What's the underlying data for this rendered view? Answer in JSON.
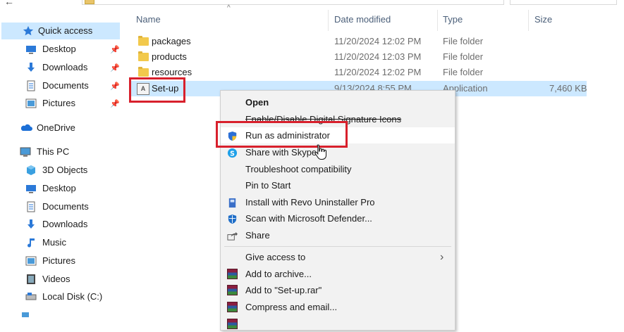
{
  "columns": {
    "name": "Name",
    "date": "Date modified",
    "type": "Type",
    "size": "Size"
  },
  "sidebar": {
    "quick_access": "Quick access",
    "quick_items": [
      {
        "label": "Desktop",
        "icon": "desktop-icon"
      },
      {
        "label": "Downloads",
        "icon": "download-icon"
      },
      {
        "label": "Documents",
        "icon": "document-icon"
      },
      {
        "label": "Pictures",
        "icon": "pictures-icon"
      }
    ],
    "onedrive": "OneDrive",
    "this_pc": "This PC",
    "pc_items": [
      {
        "label": "3D Objects",
        "icon": "cube-icon"
      },
      {
        "label": "Desktop",
        "icon": "desktop-icon"
      },
      {
        "label": "Documents",
        "icon": "document-icon"
      },
      {
        "label": "Downloads",
        "icon": "download-icon"
      },
      {
        "label": "Music",
        "icon": "music-icon"
      },
      {
        "label": "Pictures",
        "icon": "pictures-icon"
      },
      {
        "label": "Videos",
        "icon": "video-icon"
      },
      {
        "label": "Local Disk (C:)",
        "icon": "drive-icon"
      }
    ]
  },
  "files": [
    {
      "name": "packages",
      "date": "11/20/2024 12:02 PM",
      "type": "File folder",
      "size": ""
    },
    {
      "name": "products",
      "date": "11/20/2024 12:03 PM",
      "type": "File folder",
      "size": ""
    },
    {
      "name": "resources",
      "date": "11/20/2024 12:02 PM",
      "type": "File folder",
      "size": ""
    },
    {
      "name": "Set-up",
      "date": "9/13/2024 8:55 PM",
      "type": "Application",
      "size": "7,460 KB"
    }
  ],
  "context_menu": {
    "open": "Open",
    "signature": "Enable/Disable Digital Signature Icons",
    "run_admin": "Run as administrator",
    "skype": "Share with Skype",
    "troubleshoot": "Troubleshoot compatibility",
    "pin_start": "Pin to Start",
    "revo": "Install with Revo Uninstaller Pro",
    "defender": "Scan with Microsoft Defender...",
    "share": "Share",
    "give_access": "Give access to",
    "add_archive": "Add to archive...",
    "add_rar": "Add to \"Set-up.rar\"",
    "compress_email": "Compress and email..."
  },
  "colors": {
    "selection": "#cce8ff",
    "highlight_box": "#d8202c",
    "menu_bg": "#f2f2f2"
  }
}
